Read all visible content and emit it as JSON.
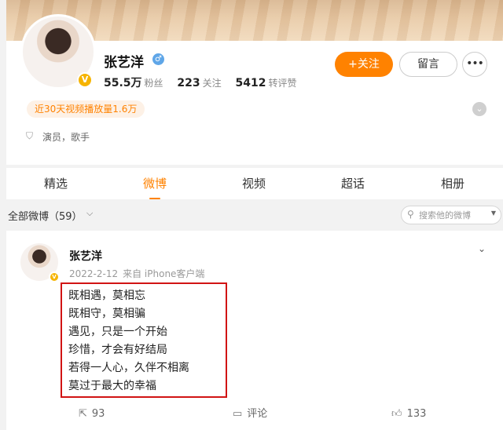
{
  "profile": {
    "name": "张艺洋",
    "verified_badge": "V",
    "gender_icon": "♂",
    "stats": [
      {
        "value": "55.5万",
        "label": "粉丝"
      },
      {
        "value": "223",
        "label": "关注"
      },
      {
        "value": "5412",
        "label": "转评赞"
      }
    ],
    "follow_label": "+关注",
    "message_label": "留言",
    "more_label": "•••",
    "plays_tag": "近30天视频播放量1.6万",
    "role": "演员，歌手"
  },
  "tabs": [
    "精选",
    "微博",
    "视频",
    "超话",
    "相册"
  ],
  "active_tab": "微博",
  "filter": {
    "label": "全部微博（59）",
    "search_placeholder": "搜索他的微博"
  },
  "post": {
    "author": "张艺洋",
    "date": "2022-2-12",
    "source": "来自 iPhone客户端",
    "lines": [
      "既相遇，莫相忘",
      "既相守，莫相骗",
      "遇见，只是一个开始",
      "珍惜，才会有好结局",
      "若得一人心，久伴不相离",
      "莫过于最大的幸福"
    ],
    "repost_count": "93",
    "comment_label": "评论",
    "like_count": "133"
  },
  "colors": {
    "accent": "#ff8200",
    "highlight_box": "#d11414",
    "verified": "#f6b400",
    "male": "#5fa6e8"
  },
  "icons": [
    "male-icon",
    "verified-icon",
    "more-dots-icon",
    "chevron-down-icon",
    "shield-icon",
    "search-icon",
    "repost-icon",
    "comment-icon",
    "like-icon"
  ]
}
